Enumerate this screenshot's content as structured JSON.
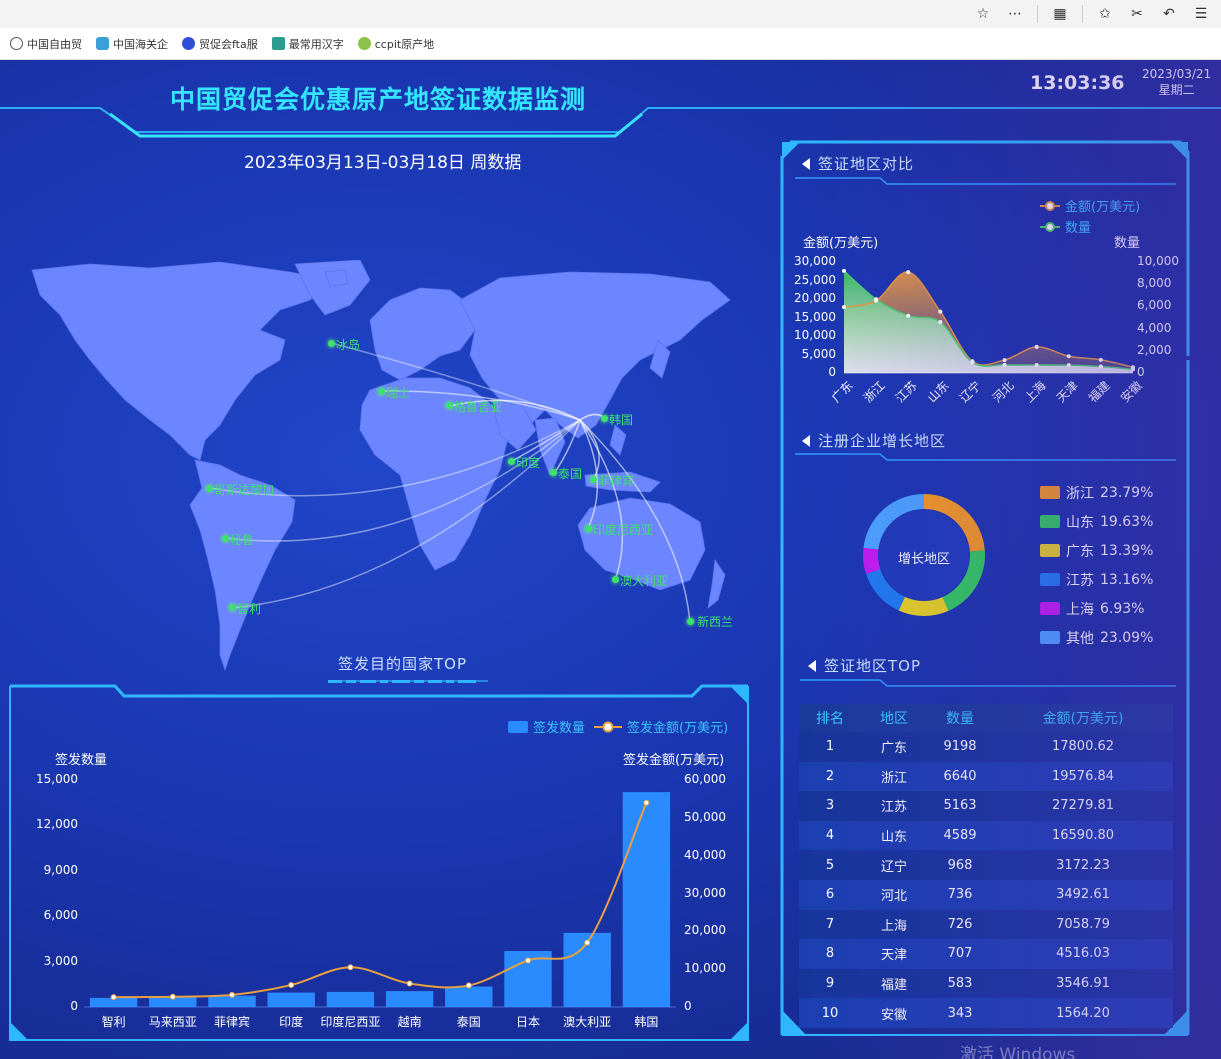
{
  "browser": {
    "bookmarks": [
      {
        "label": "中国自由贸",
        "color": "#555"
      },
      {
        "label": "中国海关企",
        "color": "#3aa0d8"
      },
      {
        "label": "贸促会fta服",
        "color": "#2f4fd8"
      },
      {
        "label": "最常用汉字",
        "color": "#2a9d8f"
      },
      {
        "label": "ccpit原产地",
        "color": "#8bc34a"
      }
    ]
  },
  "header": {
    "title": "中国贸促会优惠原产地签证数据监测",
    "clock": "13:03:36",
    "date": "2023/03/21",
    "weekday": "星期二",
    "week_range": "2023年03月13日-03月18日  周数据"
  },
  "map": {
    "countries": [
      "冰岛",
      "瑞士",
      "格鲁吉亚",
      "韩国",
      "哥斯达黎加",
      "印度",
      "泰国",
      "菲律宾",
      "秘鲁",
      "印度尼西亚",
      "澳大利亚",
      "智利",
      "新西兰"
    ]
  },
  "bottom_chart_title": "签发目的国家TOP",
  "right": {
    "sec1_title": "签证地区对比",
    "sec2_title": "注册企业增长地区",
    "sec3_title": "签证地区TOP",
    "donut_center": "增长地区",
    "donut_legend": [
      {
        "label": "浙江",
        "pct": "23.79%",
        "color": "#f39a1e"
      },
      {
        "label": "山东",
        "pct": "19.63%",
        "color": "#2fcc5a"
      },
      {
        "label": "广东",
        "pct": "13.39%",
        "color": "#e6d31e"
      },
      {
        "label": "江苏",
        "pct": "13.16%",
        "color": "#1e7cf0"
      },
      {
        "label": "上海",
        "pct": "6.93%",
        "color": "#c21cf0"
      },
      {
        "label": "其他",
        "pct": "23.09%",
        "color": "#4aa3ff"
      }
    ],
    "table": {
      "headers": [
        "排名",
        "地区",
        "数量",
        "金额(万美元)"
      ],
      "rows": [
        [
          "1",
          "广东",
          "9198",
          "17800.62"
        ],
        [
          "2",
          "浙江",
          "6640",
          "19576.84"
        ],
        [
          "3",
          "江苏",
          "5163",
          "27279.81"
        ],
        [
          "4",
          "山东",
          "4589",
          "16590.80"
        ],
        [
          "5",
          "辽宁",
          "968",
          "3172.23"
        ],
        [
          "6",
          "河北",
          "736",
          "3492.61"
        ],
        [
          "7",
          "上海",
          "726",
          "7058.79"
        ],
        [
          "8",
          "天津",
          "707",
          "4516.03"
        ],
        [
          "9",
          "福建",
          "583",
          "3546.91"
        ],
        [
          "10",
          "安徽",
          "343",
          "1564.20"
        ]
      ]
    }
  },
  "watermark": "激活 Windows",
  "chart_data": [
    {
      "type": "bar",
      "title": "签发目的国家TOP",
      "categories": [
        "智利",
        "马来西亚",
        "菲律宾",
        "印度",
        "印度尼西亚",
        "越南",
        "泰国",
        "日本",
        "澳大利亚",
        "韩国"
      ],
      "series": [
        {
          "name": "签发数量",
          "type": "bar",
          "axis": "left",
          "values": [
            600,
            650,
            750,
            950,
            1000,
            1050,
            1350,
            3700,
            4900,
            14200
          ],
          "color": "#2a8aff"
        },
        {
          "name": "签发金额(万美元)",
          "type": "line",
          "axis": "right",
          "values": [
            2600,
            2700,
            3200,
            5800,
            10500,
            6200,
            5700,
            12300,
            17000,
            54000
          ],
          "color": "#e8a040"
        }
      ],
      "ylabel": "签发数量",
      "ylabel_right": "签发金额(万美元)",
      "ylim": [
        0,
        15000
      ],
      "ylim_right": [
        0,
        60000
      ],
      "yticks": [
        "0",
        "3,000",
        "6,000",
        "9,000",
        "12,000",
        "15,000"
      ],
      "yticks_right": [
        "0",
        "10,000",
        "20,000",
        "30,000",
        "40,000",
        "50,000",
        "60,000"
      ]
    },
    {
      "type": "area",
      "title": "签证地区对比",
      "categories": [
        "广东",
        "浙江",
        "江苏",
        "山东",
        "辽宁",
        "河北",
        "上海",
        "天津",
        "福建",
        "安徽"
      ],
      "series": [
        {
          "name": "金额(万美元)",
          "axis": "left",
          "values": [
            17800.62,
            19576.84,
            27279.81,
            16590.8,
            3172.23,
            3492.61,
            7058.79,
            4516.03,
            3546.91,
            1564.2
          ],
          "color": "#e8983e"
        },
        {
          "name": "数量",
          "axis": "right",
          "values": [
            9198,
            6640,
            5163,
            4589,
            968,
            736,
            726,
            707,
            583,
            343
          ],
          "color": "#4cd06a"
        }
      ],
      "ylabel": "金额(万美元)",
      "ylabel_right": "数量",
      "ylim": [
        0,
        30000
      ],
      "ylim_right": [
        0,
        10000
      ],
      "yticks": [
        "0",
        "5,000",
        "10,000",
        "15,000",
        "20,000",
        "25,000",
        "30,000"
      ],
      "yticks_right": [
        "0",
        "2,000",
        "4,000",
        "6,000",
        "8,000",
        "10,000"
      ]
    },
    {
      "type": "pie",
      "title": "注册企业增长地区",
      "categories": [
        "浙江",
        "山东",
        "广东",
        "江苏",
        "上海",
        "其他"
      ],
      "values": [
        23.79,
        19.63,
        13.39,
        13.16,
        6.93,
        23.09
      ],
      "colors": [
        "#f39a1e",
        "#2fcc5a",
        "#e6d31e",
        "#1e7cf0",
        "#c21cf0",
        "#4aa3ff"
      ]
    }
  ]
}
